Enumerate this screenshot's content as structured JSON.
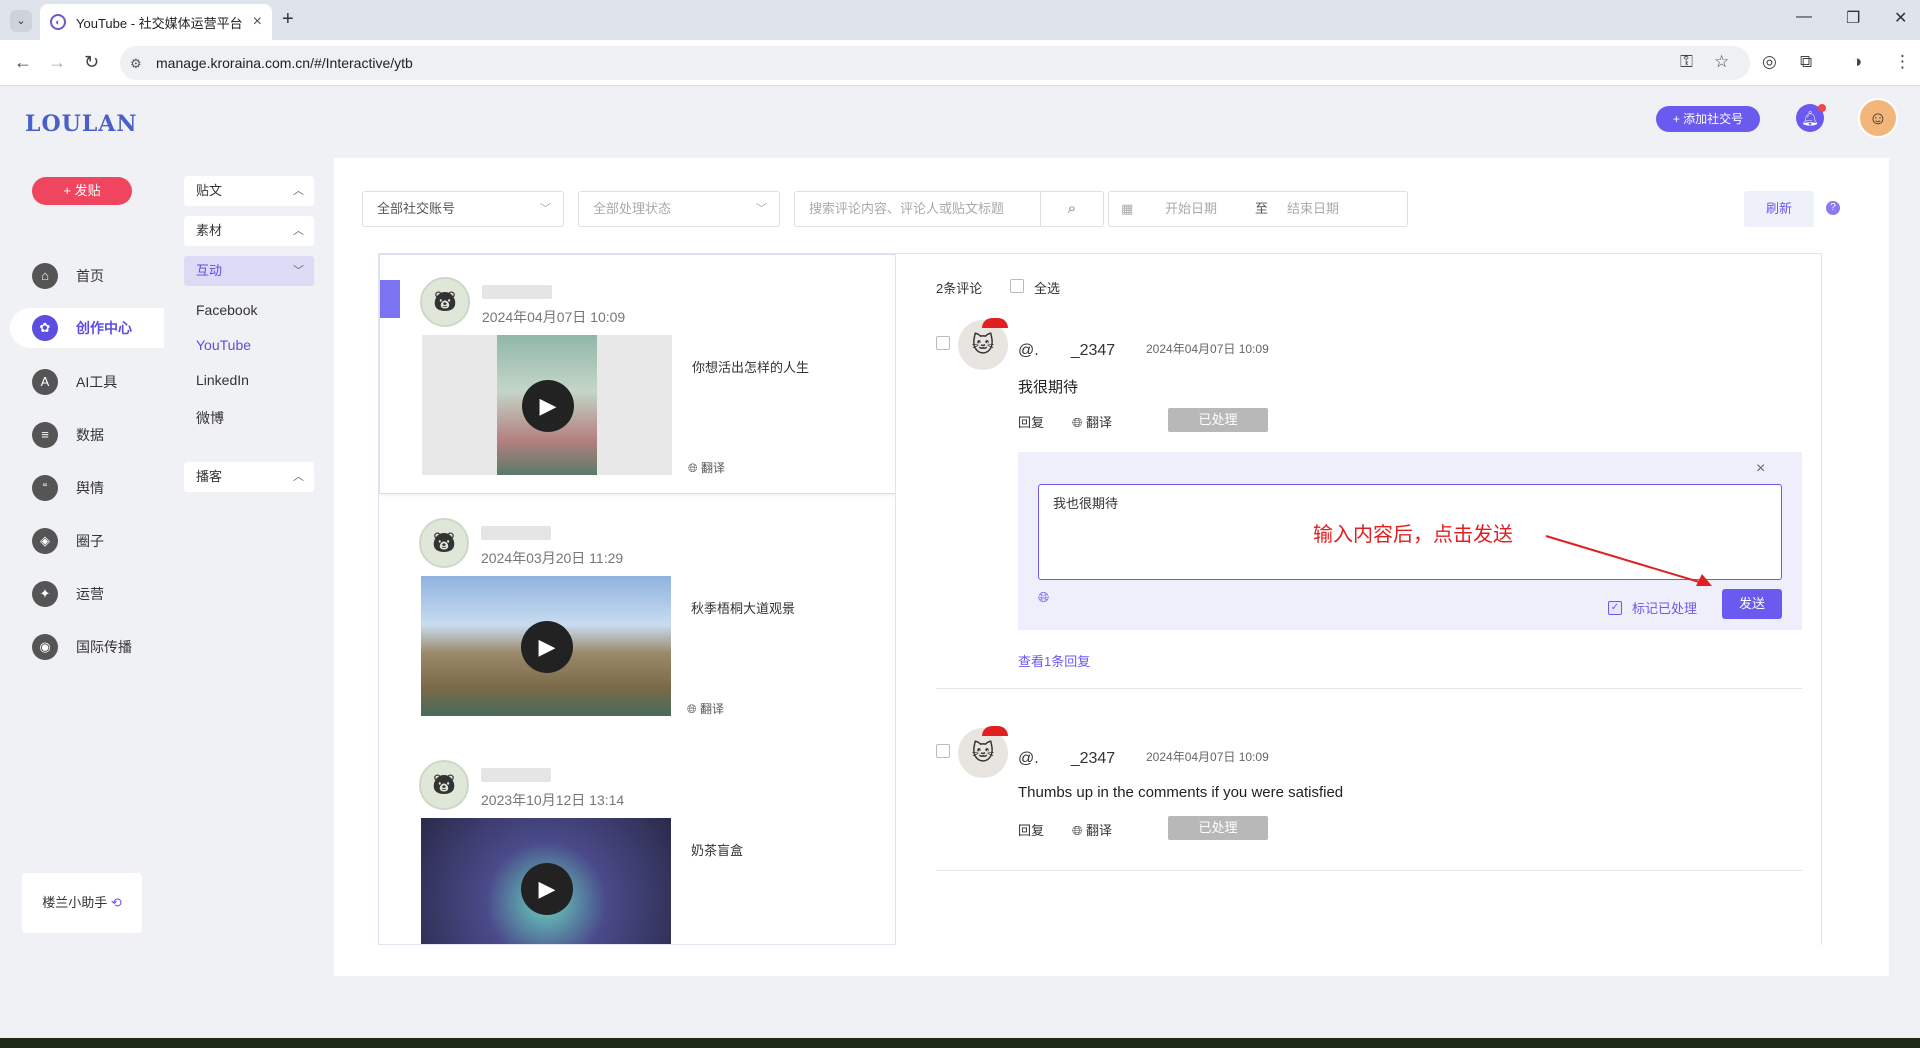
{
  "browser": {
    "tab_title": "YouTube - 社交媒体运营平台",
    "url": "manage.kroraina.com.cn/#/Interactive/ytb"
  },
  "brand": {
    "logo": "LOULAN",
    "accent": "#6a5af0",
    "post_color": "#f0455e"
  },
  "sidebar": {
    "post_button": "+ 发贴",
    "items": [
      {
        "label": "首页",
        "icon": "home-icon"
      },
      {
        "label": "创作中心",
        "icon": "palette-icon",
        "active": true
      },
      {
        "label": "AI工具",
        "icon": "ai-icon"
      },
      {
        "label": "数据",
        "icon": "database-icon"
      },
      {
        "label": "舆情",
        "icon": "quote-icon"
      },
      {
        "label": "圈子",
        "icon": "compass-icon"
      },
      {
        "label": "运营",
        "icon": "operations-icon"
      },
      {
        "label": "国际传播",
        "icon": "globe-icon"
      }
    ],
    "assistant": "楼兰小助手"
  },
  "submenu": {
    "groups": [
      "贴文",
      "素材",
      "互动",
      "播客"
    ],
    "items": [
      "Facebook",
      "YouTube",
      "LinkedIn",
      "微博"
    ]
  },
  "header": {
    "add_account": "+ 添加社交号"
  },
  "filters": {
    "account": "全部社交账号",
    "status": "全部处理状态",
    "search_placeholder": "搜索评论内容、评论人或贴文标题",
    "start_date": "开始日期",
    "date_sep": "至",
    "end_date": "结束日期",
    "refresh": "刷新"
  },
  "posts": [
    {
      "date": "2024年04月07日 10:09",
      "title": "你想活出怎样的人生",
      "translate": "翻译"
    },
    {
      "date": "2024年03月20日 11:29",
      "title": "秋季梧桐大道观景",
      "translate": "翻译"
    },
    {
      "date": "2023年10月12日 13:14",
      "title": "奶茶盲盒",
      "translate": ""
    }
  ],
  "comments_header": {
    "count": "2条评论",
    "select_all": "全选"
  },
  "comments": [
    {
      "user": "@.　　_2347",
      "time": "2024年04月07日 10:09",
      "text": "我很期待",
      "reply": "回复",
      "translate": "翻译",
      "status": "已处理"
    },
    {
      "user": "@.　　_2347",
      "time": "2024年04月07日 10:09",
      "text": "Thumbs up in the comments if you were satisfied",
      "reply": "回复",
      "translate": "翻译",
      "status": "已处理"
    }
  ],
  "reply_box": {
    "value": "我也很期待",
    "annotation": "输入内容后，点击发送",
    "mark_processed": "标记已处理",
    "send": "发送",
    "view_replies": "查看1条回复"
  }
}
